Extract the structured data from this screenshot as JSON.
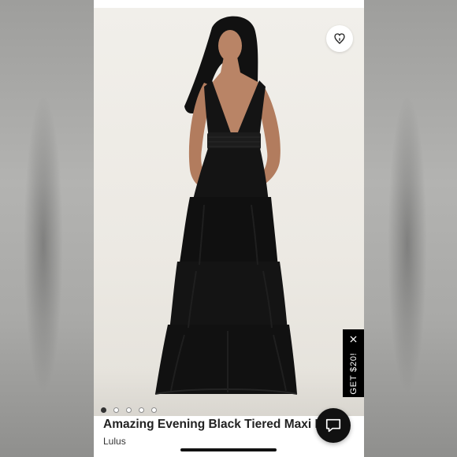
{
  "product": {
    "title": "Amazing Evening Black Tiered Maxi Dress",
    "brand": "Lulus",
    "image_description_icon": "product-photo",
    "image_count": 5,
    "active_image_index": 0
  },
  "actions": {
    "like_icon": "heart-icon",
    "chat_icon": "chat-icon"
  },
  "promo": {
    "label": "GET $20!",
    "close_icon": "close-icon"
  },
  "colors": {
    "promo_bg": "#000000",
    "chat_bg": "#111111",
    "dress": "#141414",
    "backdrop": "#efece6"
  }
}
